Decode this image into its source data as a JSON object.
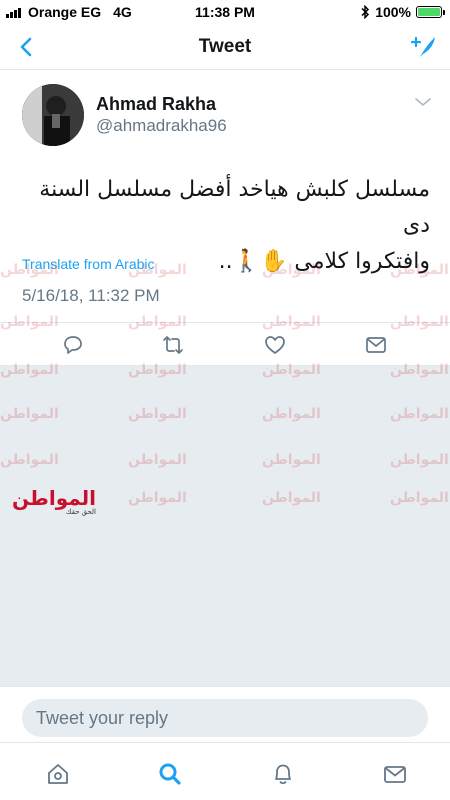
{
  "status_bar": {
    "carrier": "Orange EG",
    "network": "4G",
    "time": "11:38 PM",
    "battery": "100%",
    "battery_level": 1.0
  },
  "nav": {
    "title": "Tweet",
    "back_icon": "chevron-left-icon",
    "compose_icon": "compose-tweet-icon"
  },
  "tweet": {
    "author_name": "Ahmad Rakha",
    "author_handle": "@ahmadrakha96",
    "text_line1": "مسلسل كلبش هياخد أفضل مسلسل السنة دى",
    "text_line2": "وافتكروا كلامى ✋🚶..",
    "translate_label": "Translate from Arabic",
    "timestamp": "5/16/18, 11:32 PM"
  },
  "actions": {
    "reply_icon": "reply-icon",
    "retweet_icon": "retweet-icon",
    "like_icon": "heart-icon",
    "dm_icon": "envelope-icon"
  },
  "watermark": {
    "text": "المواطن",
    "logo_text": "المواطن",
    "logo_sub": "الحق حقك"
  },
  "reply": {
    "placeholder": "Tweet your reply"
  },
  "tabs": {
    "home": "home-icon",
    "search": "search-icon",
    "notifications": "bell-icon",
    "messages": "envelope-icon"
  },
  "colors": {
    "accent": "#1da1f2",
    "muted": "#657786",
    "divider": "#e1e8ed",
    "background_gray": "#e6ecf0",
    "watermark_red": "#c8102e"
  }
}
